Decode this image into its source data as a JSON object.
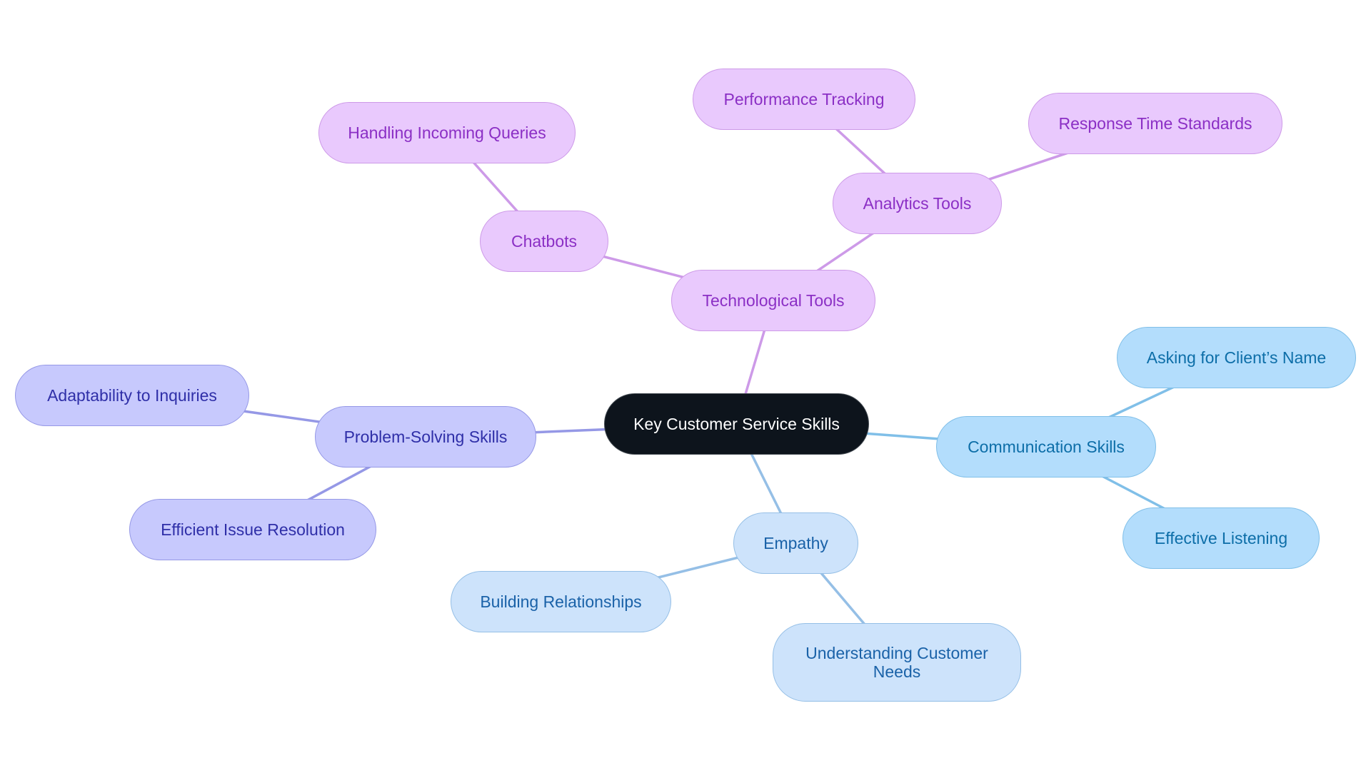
{
  "diagram": {
    "type": "mindmap",
    "root": {
      "id": "root",
      "label": "Key Customer Service Skills"
    },
    "colors": {
      "root_fill": "#0d141c",
      "root_text": "#ffffff",
      "technological_fill": "#e9c9fd",
      "technological_stroke": "#cd9ae8",
      "technological_text": "#8b2fc5",
      "communication_fill": "#b3ddfc",
      "communication_stroke": "#80bfe8",
      "communication_text": "#0d6ea8",
      "empathy_fill": "#cde3fb",
      "empathy_stroke": "#95bfe6",
      "empathy_text": "#1a62a8",
      "problem_fill": "#c7c9fd",
      "problem_stroke": "#9598e6",
      "problem_text": "#2f2fa8"
    },
    "nodes": [
      {
        "id": "root",
        "label": "Key Customer Service Skills",
        "parent": null,
        "theme": "root"
      },
      {
        "id": "tech",
        "label": "Technological Tools",
        "parent": "root",
        "theme": "purple"
      },
      {
        "id": "chatbots",
        "label": "Chatbots",
        "parent": "tech",
        "theme": "purple"
      },
      {
        "id": "handling",
        "label": "Handling Incoming Queries",
        "parent": "chatbots",
        "theme": "purple"
      },
      {
        "id": "analytics",
        "label": "Analytics Tools",
        "parent": "tech",
        "theme": "purple"
      },
      {
        "id": "performance",
        "label": "Performance Tracking",
        "parent": "analytics",
        "theme": "purple"
      },
      {
        "id": "response",
        "label": "Response Time Standards",
        "parent": "analytics",
        "theme": "purple"
      },
      {
        "id": "communication",
        "label": "Communication Skills",
        "parent": "root",
        "theme": "sky"
      },
      {
        "id": "asking",
        "label": "Asking for Client’s Name",
        "parent": "communication",
        "theme": "sky"
      },
      {
        "id": "listening",
        "label": "Effective Listening",
        "parent": "communication",
        "theme": "sky"
      },
      {
        "id": "empathy",
        "label": "Empathy",
        "parent": "root",
        "theme": "pale"
      },
      {
        "id": "relationships",
        "label": "Building Relationships",
        "parent": "empathy",
        "theme": "pale"
      },
      {
        "id": "understanding",
        "label": "Understanding Customer Needs",
        "parent": "empathy",
        "theme": "pale"
      },
      {
        "id": "problem",
        "label": "Problem-Solving Skills",
        "parent": "root",
        "theme": "indigo"
      },
      {
        "id": "adaptability",
        "label": "Adaptability to Inquiries",
        "parent": "problem",
        "theme": "indigo"
      },
      {
        "id": "efficient",
        "label": "Efficient Issue Resolution",
        "parent": "problem",
        "theme": "indigo"
      }
    ]
  }
}
